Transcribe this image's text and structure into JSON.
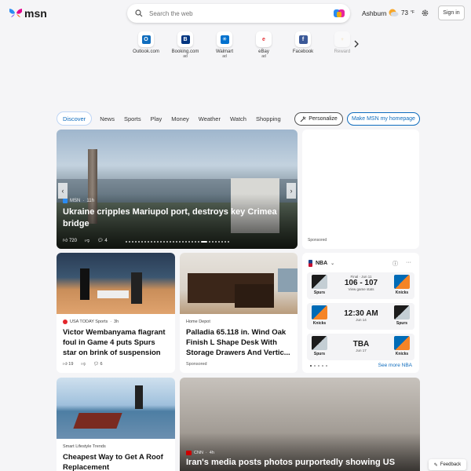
{
  "header": {
    "logo_text": "msn",
    "search_placeholder": "Search the web",
    "location": "Ashburn",
    "temperature": "73",
    "temp_unit": "°F",
    "signin_label": "Sign in"
  },
  "quick_links": [
    {
      "name": "Outlook.com",
      "ad": "",
      "letter": "O",
      "color": "#0f6cbd"
    },
    {
      "name": "Booking.com",
      "ad": "ad",
      "letter": "B",
      "color": "#003580"
    },
    {
      "name": "Walmart",
      "ad": "ad",
      "letter": "✳",
      "color": "#0071ce"
    },
    {
      "name": "eBay",
      "ad": "ad",
      "letter": "e",
      "color": "#e53238"
    },
    {
      "name": "Facebook",
      "ad": "",
      "letter": "f",
      "color": "#3b5998"
    },
    {
      "name": "Reward",
      "ad": "",
      "letter": "♆",
      "color": "#e8b84a"
    }
  ],
  "nav": {
    "tabs": [
      "Discover",
      "News",
      "Sports",
      "Play",
      "Money",
      "Weather",
      "Watch",
      "Shopping"
    ],
    "personalize_label": "Personalize",
    "make_home_label": "Make MSN my homepage"
  },
  "hero": {
    "source": "MSN",
    "age": "11h",
    "title": "Ukraine cripples Mariupol port, destroys key Crimea bridge",
    "likes": "720",
    "comments": "4"
  },
  "ad_box": {
    "sponsored": "Sponsored"
  },
  "cards": [
    {
      "source": "USA TODAY Sports",
      "age": "3h",
      "title": "Victor Wembanyama flagrant foul in Game 4 puts Spurs star on brink of suspension",
      "likes": "19",
      "comments": "6"
    },
    {
      "source": "Home Depot",
      "title": "Palladia 65.118 in. Wind Oak Finish L Shape Desk With Storage Drawers And Vertic...",
      "sponsored": "Sponsored"
    },
    {
      "source": "Smart Lifestyle Trends",
      "title": "Cheapest Way to Get A Roof Replacement"
    },
    {
      "source": "CNN",
      "age": "4h",
      "title": "Iran's media posts photos purportedly showing US"
    }
  ],
  "nba": {
    "league": "NBA",
    "games": [
      {
        "status": "Final · Jun 11",
        "score": "106 - 107",
        "sub": "View game stats",
        "home": "Spurs",
        "away": "Knicks"
      },
      {
        "status": "",
        "score": "12:30 AM",
        "sub": "Jun 14",
        "home": "Knicks",
        "away": "Spurs"
      },
      {
        "status": "",
        "score": "TBA",
        "sub": "Jun 17",
        "home": "Spurs",
        "away": "Knicks"
      }
    ],
    "see_more": "See more NBA"
  },
  "feedback_label": "Feedback",
  "colors": {
    "accent": "#0f6cbd",
    "spurs": "#1c1c1c",
    "knicks": "#006bb6",
    "knicks_orange": "#f58426"
  }
}
